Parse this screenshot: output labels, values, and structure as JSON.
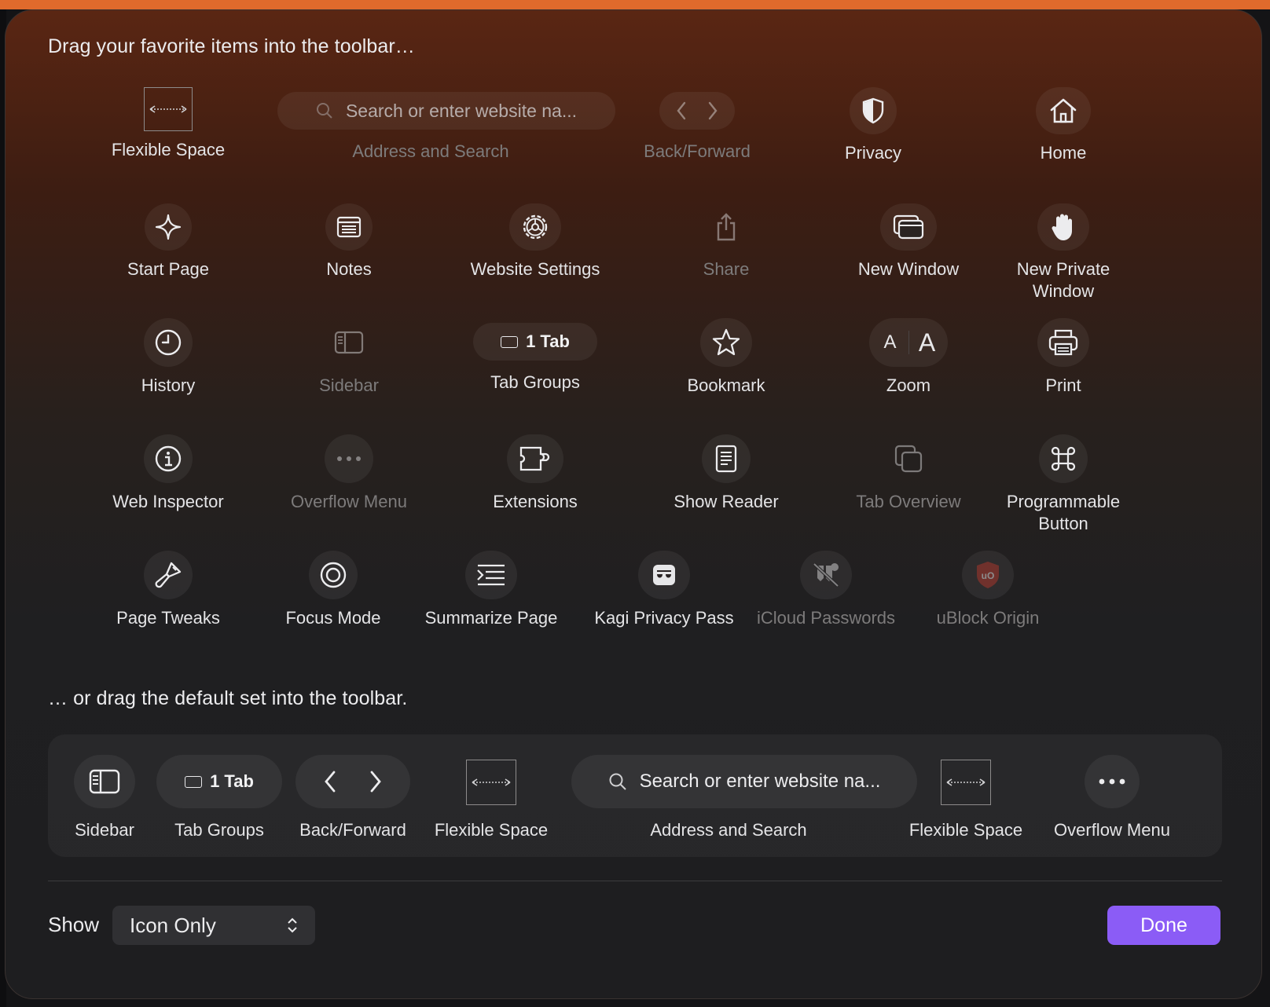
{
  "heading_top": "Drag your favorite items into the toolbar…",
  "heading_default": "… or drag the default set into the toolbar.",
  "search_placeholder": "Search or enter website na...",
  "tab_pill_label": "1 Tab",
  "zoom_small": "A",
  "zoom_large": "A",
  "items": {
    "flexible_space": "Flexible Space",
    "address_search": "Address and Search",
    "back_forward": "Back/Forward",
    "privacy": "Privacy",
    "home": "Home",
    "start_page": "Start Page",
    "notes": "Notes",
    "website_settings": "Website Settings",
    "share": "Share",
    "new_window": "New Window",
    "new_private_window": "New Private Window",
    "history": "History",
    "sidebar": "Sidebar",
    "tab_groups": "Tab Groups",
    "bookmark": "Bookmark",
    "zoom": "Zoom",
    "print": "Print",
    "web_inspector": "Web Inspector",
    "overflow_menu": "Overflow Menu",
    "extensions": "Extensions",
    "show_reader": "Show Reader",
    "tab_overview": "Tab Overview",
    "programmable_button": "Programmable Button",
    "page_tweaks": "Page Tweaks",
    "focus_mode": "Focus Mode",
    "summarize_page": "Summarize Page",
    "kagi_privacy_pass": "Kagi Privacy Pass",
    "icloud_passwords": "iCloud Passwords",
    "ublock_origin": "uBlock Origin"
  },
  "default_set": {
    "sidebar": "Sidebar",
    "tab_groups": "Tab Groups",
    "back_forward": "Back/Forward",
    "flexible_space_1": "Flexible Space",
    "address_search": "Address and Search",
    "flexible_space_2": "Flexible Space",
    "overflow_menu": "Overflow Menu"
  },
  "footer": {
    "show_label": "Show",
    "show_value": "Icon Only",
    "done_label": "Done"
  },
  "colors": {
    "accent": "#8b5cf6",
    "top_bar": "#e06a2c",
    "ublock_red": "#9b1c1c"
  }
}
